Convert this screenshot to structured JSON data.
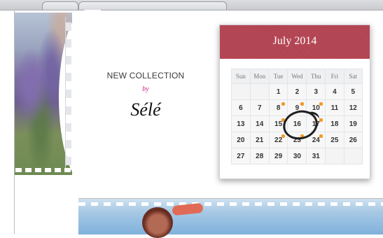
{
  "headline": {
    "collection": "NEW COLLECTION",
    "by": "by",
    "brand": "Sélé"
  },
  "calendar": {
    "month_title": "July 2014",
    "weekdays": [
      "Sun",
      "Mon",
      "Tue",
      "Wed",
      "Thu",
      "Fri",
      "Sat"
    ],
    "weeks": [
      [
        "",
        "",
        "1",
        "2",
        "3",
        "4",
        "5"
      ],
      [
        "6",
        "7",
        "8",
        "9",
        "10",
        "11",
        "12"
      ],
      [
        "13",
        "14",
        "15",
        "16",
        "17",
        "18",
        "19"
      ],
      [
        "20",
        "21",
        "22",
        "23",
        "24",
        "25",
        "26"
      ],
      [
        "27",
        "28",
        "29",
        "30",
        "31",
        "",
        ""
      ]
    ],
    "marked_days": [
      "8",
      "9",
      "10",
      "15",
      "17",
      "22",
      "23",
      "24"
    ],
    "circled_day": "16",
    "accent_color": "#b0434f",
    "marker_color": "#f29a28"
  }
}
